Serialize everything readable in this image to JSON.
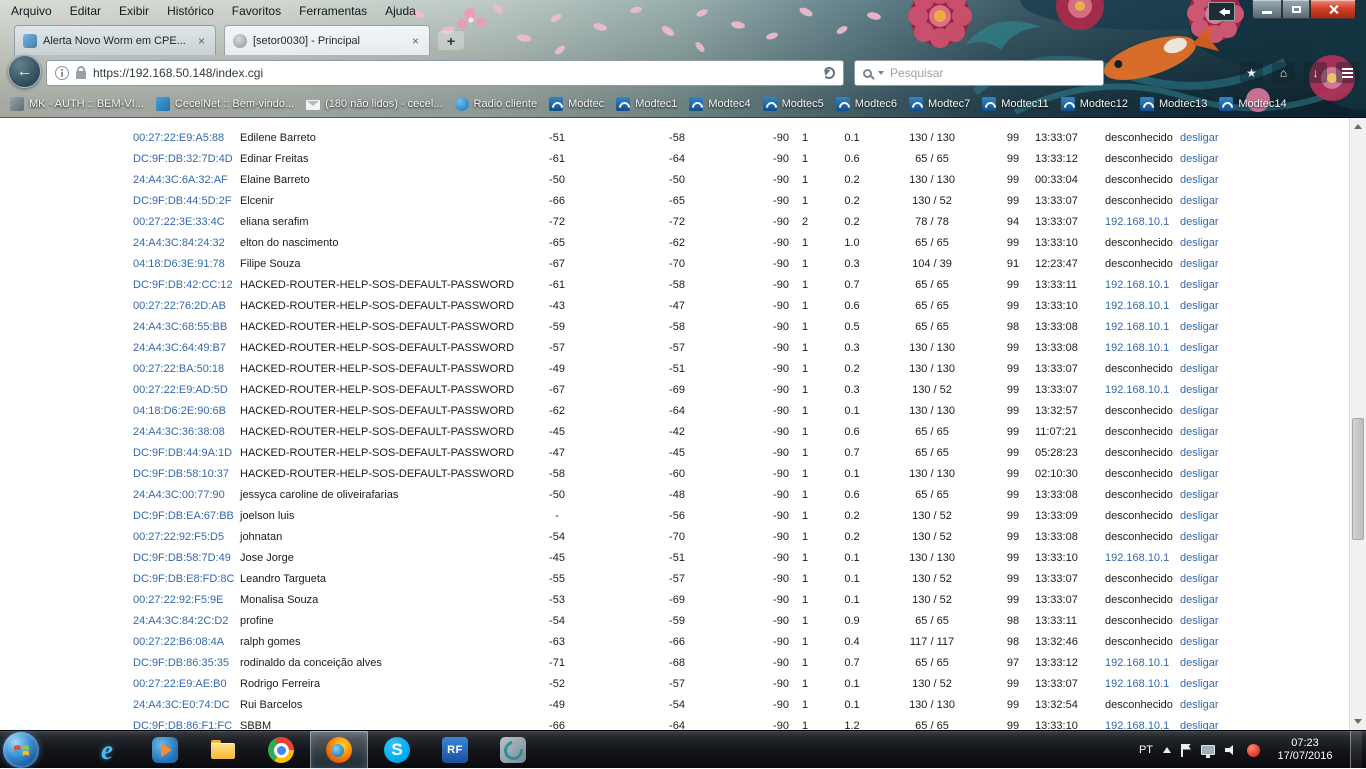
{
  "menubar": {
    "items": [
      "Arquivo",
      "Editar",
      "Exibir",
      "Histórico",
      "Favoritos",
      "Ferramentas",
      "Ajuda"
    ]
  },
  "tabs": {
    "tab1": {
      "title": "Alerta Novo Worm em CPE...",
      "close_glyph": "×"
    },
    "tab2": {
      "title": "[setor0030] - Principal",
      "close_glyph": "×"
    },
    "new_tab_glyph": "+"
  },
  "navbar": {
    "back_glyph": "←",
    "url": "https://192.168.50.148/index.cgi",
    "search_placeholder": "Pesquisar",
    "home_glyph": "⌂",
    "download_glyph": "↓",
    "star_glyph": "★"
  },
  "bookmarks": {
    "items": [
      {
        "label": "MK - AUTH :: BEM-VI...",
        "icon": "mk-auth-favicon"
      },
      {
        "label": "CecelNet :: Bem-vindo...",
        "icon": "cecelnet-favicon"
      },
      {
        "label": "(180 não lidos) - cecel...",
        "icon": "envelope-icon"
      },
      {
        "label": "Radio cliente",
        "icon": "radio-favicon"
      },
      {
        "label": "Modtec",
        "icon": "modtec-favicon"
      },
      {
        "label": "Modtec1",
        "icon": "modtec-favicon"
      },
      {
        "label": "Modtec4",
        "icon": "modtec-favicon"
      },
      {
        "label": "Modtec5",
        "icon": "modtec-favicon"
      },
      {
        "label": "Modtec6",
        "icon": "modtec-favicon"
      },
      {
        "label": "Modtec7",
        "icon": "modtec-favicon"
      },
      {
        "label": "Modtec11",
        "icon": "modtec-favicon"
      },
      {
        "label": "Modtec12",
        "icon": "modtec-favicon"
      },
      {
        "label": "Modtec13",
        "icon": "modtec-favicon"
      },
      {
        "label": "Modtec14",
        "icon": "modtec-favicon"
      }
    ]
  },
  "clients_table": {
    "rows": [
      [
        "00:27:22:E9:A5:88",
        "Edilene Barreto",
        "-51",
        "-58",
        "-90",
        "1",
        "0.1",
        "130 / 130",
        "99",
        "13:33:07",
        "desconhecido",
        "desligar"
      ],
      [
        "DC:9F:DB:32:7D:4D",
        "Edinar Freitas",
        "-61",
        "-64",
        "-90",
        "1",
        "0.6",
        "65 / 65",
        "99",
        "13:33:12",
        "desconhecido",
        "desligar"
      ],
      [
        "24:A4:3C:6A:32:AF",
        "Elaine Barreto",
        "-50",
        "-50",
        "-90",
        "1",
        "0.2",
        "130 / 130",
        "99",
        "00:33:04",
        "desconhecido",
        "desligar"
      ],
      [
        "DC:9F:DB:44:5D:2F",
        "Elcenir",
        "-66",
        "-65",
        "-90",
        "1",
        "0.2",
        "130 / 52",
        "99",
        "13:33:07",
        "desconhecido",
        "desligar"
      ],
      [
        "00:27:22:3E:33:4C",
        "eliana serafim",
        "-72",
        "-72",
        "-90",
        "2",
        "0.2",
        "78 / 78",
        "94",
        "13:33:07",
        "192.168.10.1",
        "desligar"
      ],
      [
        "24:A4:3C:84:24:32",
        "elton do nascimento",
        "-65",
        "-62",
        "-90",
        "1",
        "1.0",
        "65 / 65",
        "99",
        "13:33:10",
        "desconhecido",
        "desligar"
      ],
      [
        "04:18:D6:3E:91:78",
        "Filipe Souza",
        "-67",
        "-70",
        "-90",
        "1",
        "0.3",
        "104 / 39",
        "91",
        "12:23:47",
        "desconhecido",
        "desligar"
      ],
      [
        "DC:9F:DB:42:CC:12",
        "HACKED-ROUTER-HELP-SOS-DEFAULT-PASSWORD",
        "-61",
        "-58",
        "-90",
        "1",
        "0.7",
        "65 / 65",
        "99",
        "13:33:11",
        "192.168.10.1",
        "desligar"
      ],
      [
        "00:27:22:76:2D:AB",
        "HACKED-ROUTER-HELP-SOS-DEFAULT-PASSWORD",
        "-43",
        "-47",
        "-90",
        "1",
        "0.6",
        "65 / 65",
        "99",
        "13:33:10",
        "192.168.10.1",
        "desligar"
      ],
      [
        "24:A4:3C:68:55:BB",
        "HACKED-ROUTER-HELP-SOS-DEFAULT-PASSWORD",
        "-59",
        "-58",
        "-90",
        "1",
        "0.5",
        "65 / 65",
        "98",
        "13:33:08",
        "192.168.10.1",
        "desligar"
      ],
      [
        "24:A4:3C:64:49:B7",
        "HACKED-ROUTER-HELP-SOS-DEFAULT-PASSWORD",
        "-57",
        "-57",
        "-90",
        "1",
        "0.3",
        "130 / 130",
        "99",
        "13:33:08",
        "192.168.10.1",
        "desligar"
      ],
      [
        "00:27:22:BA:50:18",
        "HACKED-ROUTER-HELP-SOS-DEFAULT-PASSWORD",
        "-49",
        "-51",
        "-90",
        "1",
        "0.2",
        "130 / 130",
        "99",
        "13:33:07",
        "desconhecido",
        "desligar"
      ],
      [
        "00:27:22:E9:AD:5D",
        "HACKED-ROUTER-HELP-SOS-DEFAULT-PASSWORD",
        "-67",
        "-69",
        "-90",
        "1",
        "0.3",
        "130 / 52",
        "99",
        "13:33:07",
        "192.168.10.1",
        "desligar"
      ],
      [
        "04:18:D6:2E:90:6B",
        "HACKED-ROUTER-HELP-SOS-DEFAULT-PASSWORD",
        "-62",
        "-64",
        "-90",
        "1",
        "0.1",
        "130 / 130",
        "99",
        "13:32:57",
        "desconhecido",
        "desligar"
      ],
      [
        "24:A4:3C:36:38:08",
        "HACKED-ROUTER-HELP-SOS-DEFAULT-PASSWORD",
        "-45",
        "-42",
        "-90",
        "1",
        "0.6",
        "65 / 65",
        "99",
        "11:07:21",
        "desconhecido",
        "desligar"
      ],
      [
        "DC:9F:DB:44:9A:1D",
        "HACKED-ROUTER-HELP-SOS-DEFAULT-PASSWORD",
        "-47",
        "-45",
        "-90",
        "1",
        "0.7",
        "65 / 65",
        "99",
        "05:28:23",
        "desconhecido",
        "desligar"
      ],
      [
        "DC:9F:DB:58:10:37",
        "HACKED-ROUTER-HELP-SOS-DEFAULT-PASSWORD",
        "-58",
        "-60",
        "-90",
        "1",
        "0.1",
        "130 / 130",
        "99",
        "02:10:30",
        "desconhecido",
        "desligar"
      ],
      [
        "24:A4:3C:00:77:90",
        "jessyca caroline de oliveirafarias",
        "-50",
        "-48",
        "-90",
        "1",
        "0.6",
        "65 / 65",
        "99",
        "13:33:08",
        "desconhecido",
        "desligar"
      ],
      [
        "DC:9F:DB:EA:67:BB",
        "joelson luis",
        "-",
        "-56",
        "-90",
        "1",
        "0.2",
        "130 / 52",
        "99",
        "13:33:09",
        "desconhecido",
        "desligar"
      ],
      [
        "00:27:22:92:F5:D5",
        "johnatan",
        "-54",
        "-70",
        "-90",
        "1",
        "0.2",
        "130 / 52",
        "99",
        "13:33:08",
        "desconhecido",
        "desligar"
      ],
      [
        "DC:9F:DB:58:7D:49",
        "Jose Jorge",
        "-45",
        "-51",
        "-90",
        "1",
        "0.1",
        "130 / 130",
        "99",
        "13:33:10",
        "192.168.10.1",
        "desligar"
      ],
      [
        "DC:9F:DB:E8:FD:8C",
        "Leandro Targueta",
        "-55",
        "-57",
        "-90",
        "1",
        "0.1",
        "130 / 52",
        "99",
        "13:33:07",
        "desconhecido",
        "desligar"
      ],
      [
        "00:27:22:92:F5:9E",
        "Monalisa Souza",
        "-53",
        "-69",
        "-90",
        "1",
        "0.1",
        "130 / 52",
        "99",
        "13:33:07",
        "desconhecido",
        "desligar"
      ],
      [
        "24:A4:3C:84:2C:D2",
        "profine",
        "-54",
        "-59",
        "-90",
        "1",
        "0.9",
        "65 / 65",
        "98",
        "13:33:11",
        "desconhecido",
        "desligar"
      ],
      [
        "00:27:22:B6:08:4A",
        "ralph gomes",
        "-63",
        "-66",
        "-90",
        "1",
        "0.4",
        "117 / 117",
        "98",
        "13:32:46",
        "desconhecido",
        "desligar"
      ],
      [
        "DC:9F:DB:86:35:35",
        "rodinaldo da conceição alves",
        "-71",
        "-68",
        "-90",
        "1",
        "0.7",
        "65 / 65",
        "97",
        "13:33:12",
        "192.168.10.1",
        "desligar"
      ],
      [
        "00:27:22:E9:AE:B0",
        "Rodrigo Ferreira",
        "-52",
        "-57",
        "-90",
        "1",
        "0.1",
        "130 / 52",
        "99",
        "13:33:07",
        "192.168.10.1",
        "desligar"
      ],
      [
        "24:A4:3C:E0:74:DC",
        "Rui Barcelos",
        "-49",
        "-54",
        "-90",
        "1",
        "0.1",
        "130 / 130",
        "99",
        "13:32:54",
        "desconhecido",
        "desligar"
      ],
      [
        "DC:9F:DB:86:F1:FC",
        "SBBM",
        "-66",
        "-64",
        "-90",
        "1",
        "1.2",
        "65 / 65",
        "99",
        "13:33:10",
        "192.168.10.1",
        "desligar"
      ]
    ]
  },
  "taskbar": {
    "apps": [
      {
        "icon": "internet-explorer-icon",
        "glyph": "e",
        "active": false
      },
      {
        "icon": "media-player-icon",
        "glyph": "",
        "active": false
      },
      {
        "icon": "explorer-folder-icon",
        "glyph": "",
        "active": false
      },
      {
        "icon": "chrome-icon",
        "glyph": "",
        "active": false
      },
      {
        "icon": "firefox-icon",
        "glyph": "",
        "active": true
      },
      {
        "icon": "skype-icon",
        "glyph": "S",
        "active": false
      },
      {
        "icon": "rf-tool-icon",
        "glyph": "RF",
        "active": false
      },
      {
        "icon": "swirl-app-icon",
        "glyph": "",
        "active": false
      }
    ],
    "tray": {
      "language": "PT",
      "time": "07:23",
      "date": "17/07/2016"
    }
  },
  "colors": {
    "link": "#3468a8",
    "close_button": "#c8402c",
    "persona_dark": "#0f2b39"
  }
}
